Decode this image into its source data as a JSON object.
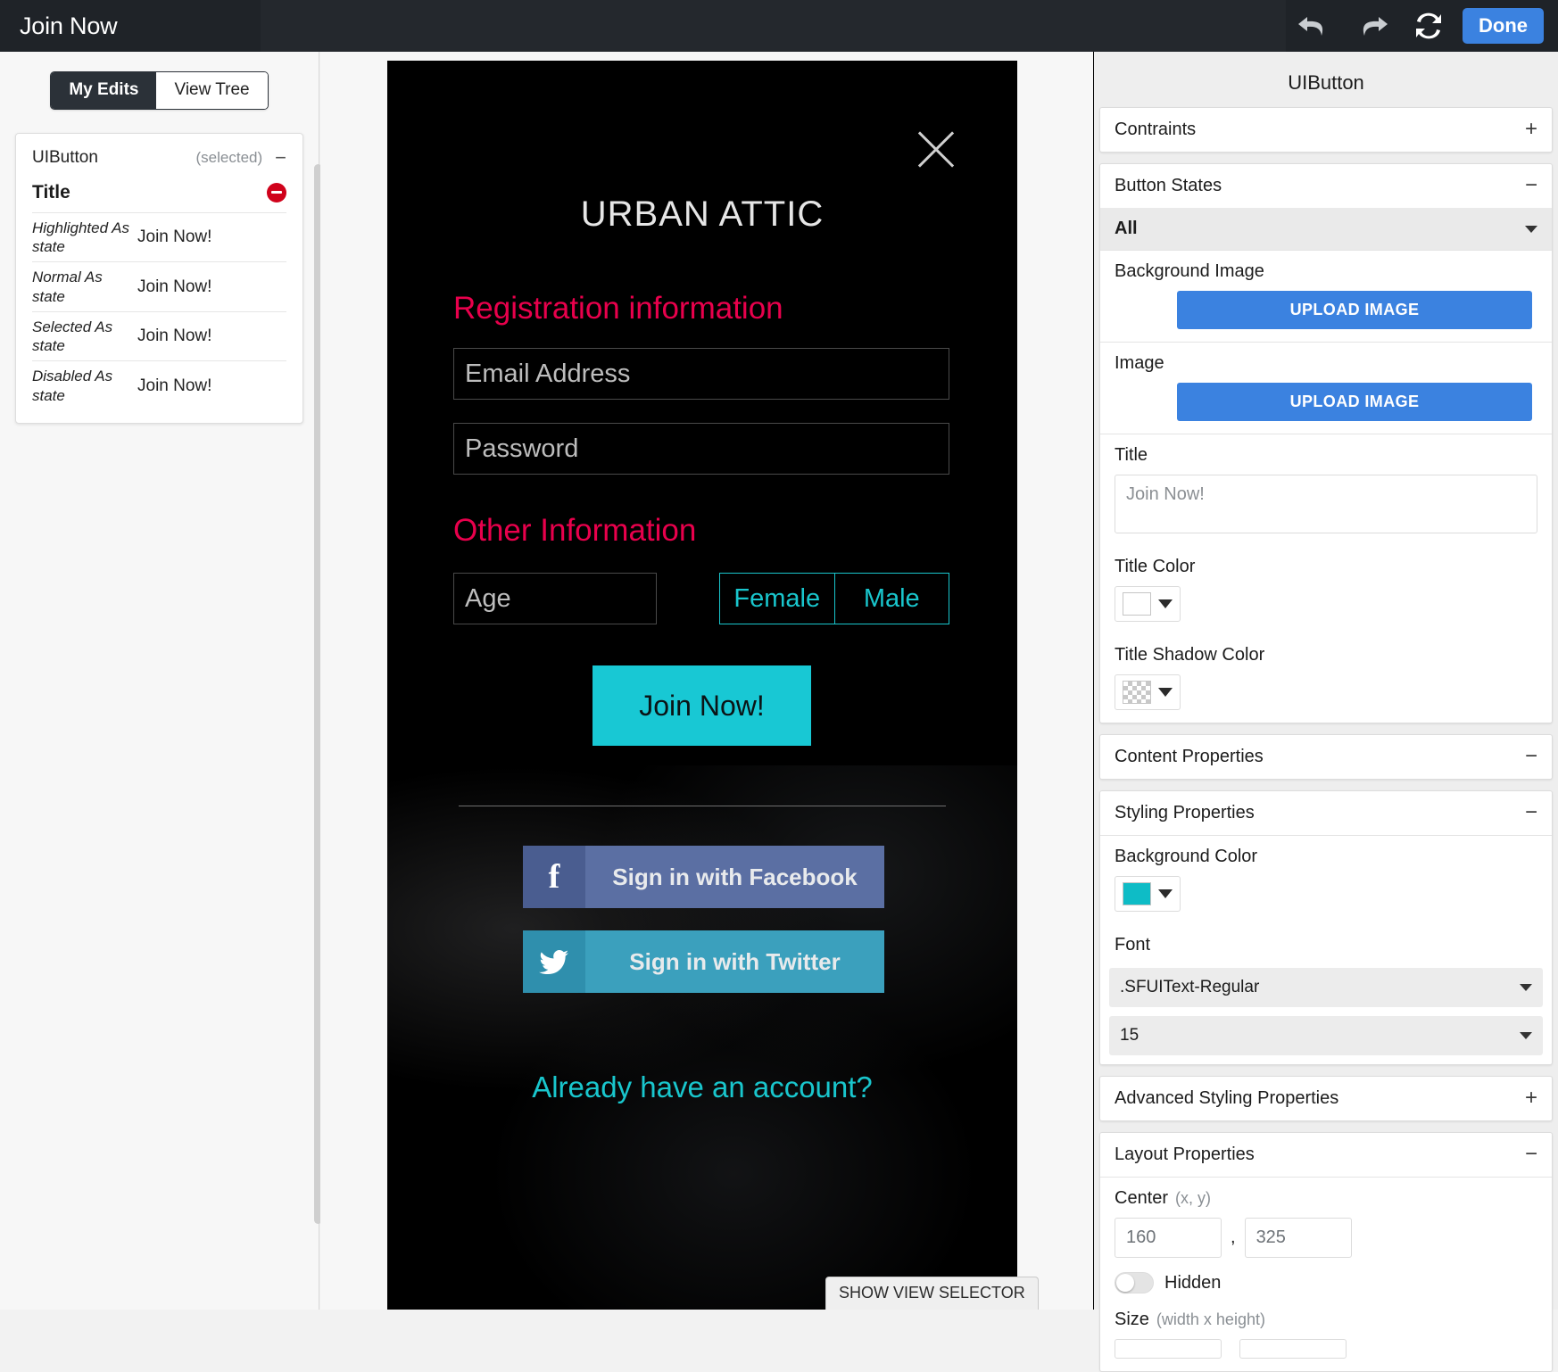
{
  "topbar": {
    "title": "Join Now",
    "undo_icon": "undo-arrow-icon",
    "redo_icon": "redo-arrow-icon",
    "refresh_icon": "refresh-icon",
    "done_label": "Done",
    "accent": "#3b82e0"
  },
  "left": {
    "tabs": [
      {
        "label": "My Edits",
        "active": true
      },
      {
        "label": "View Tree",
        "active": false
      }
    ],
    "card": {
      "element_name": "UIButton",
      "status": "(selected)",
      "collapse_glyph": "−",
      "property_title": "Title",
      "rows": [
        {
          "key": "Highlighted As state",
          "value": "Join Now!"
        },
        {
          "key": "Normal As state",
          "value": "Join Now!"
        },
        {
          "key": "Selected As state",
          "value": "Join Now!"
        },
        {
          "key": "Disabled As state",
          "value": "Join Now!"
        }
      ]
    }
  },
  "preview": {
    "close_icon": "close-x-icon",
    "brand": "URBAN ATTIC",
    "section_registration": "Registration information",
    "section_other": "Other Information",
    "email_placeholder": "Email Address",
    "password_placeholder": "Password",
    "age_placeholder": "Age",
    "gender_female": "Female",
    "gender_male": "Male",
    "join_button": "Join Now!",
    "facebook_label": "Sign in with Facebook",
    "facebook_icon": "facebook-icon",
    "twitter_label": "Sign in with Twitter",
    "twitter_icon": "twitter-bird-icon",
    "already_account": "Already have an account?",
    "view_selector_label": "SHOW VIEW SELECTOR",
    "accent_pink": "#e8004c",
    "accent_cyan": "#19c6cd"
  },
  "inspector": {
    "title": "UIButton",
    "constraints": {
      "label": "Contraints",
      "toggle": "+"
    },
    "button_states": {
      "label": "Button States",
      "toggle": "−",
      "selected_state": "All",
      "background_image_label": "Background Image",
      "background_image_button": "UPLOAD IMAGE",
      "image_label": "Image",
      "image_button": "UPLOAD IMAGE",
      "title_label": "Title",
      "title_value": "Join Now!",
      "title_color_label": "Title Color",
      "title_color_value": "#ffffff",
      "title_shadow_color_label": "Title Shadow Color",
      "title_shadow_color_value": "clear"
    },
    "content_properties": {
      "label": "Content Properties",
      "toggle": "−"
    },
    "styling_properties": {
      "label": "Styling Properties",
      "toggle": "−",
      "background_color_label": "Background Color",
      "background_color_value": "#0ebcc6",
      "font_label": "Font",
      "font_family": ".SFUIText-Regular",
      "font_size": "15"
    },
    "advanced_styling": {
      "label": "Advanced Styling Properties",
      "toggle": "+"
    },
    "layout_properties": {
      "label": "Layout Properties",
      "toggle": "−",
      "center_label": "Center",
      "center_hint": "(x, y)",
      "center_x": "160",
      "center_y": "325",
      "comma": ",",
      "hidden_label": "Hidden",
      "size_label": "Size",
      "size_hint": "(width x height)"
    }
  }
}
